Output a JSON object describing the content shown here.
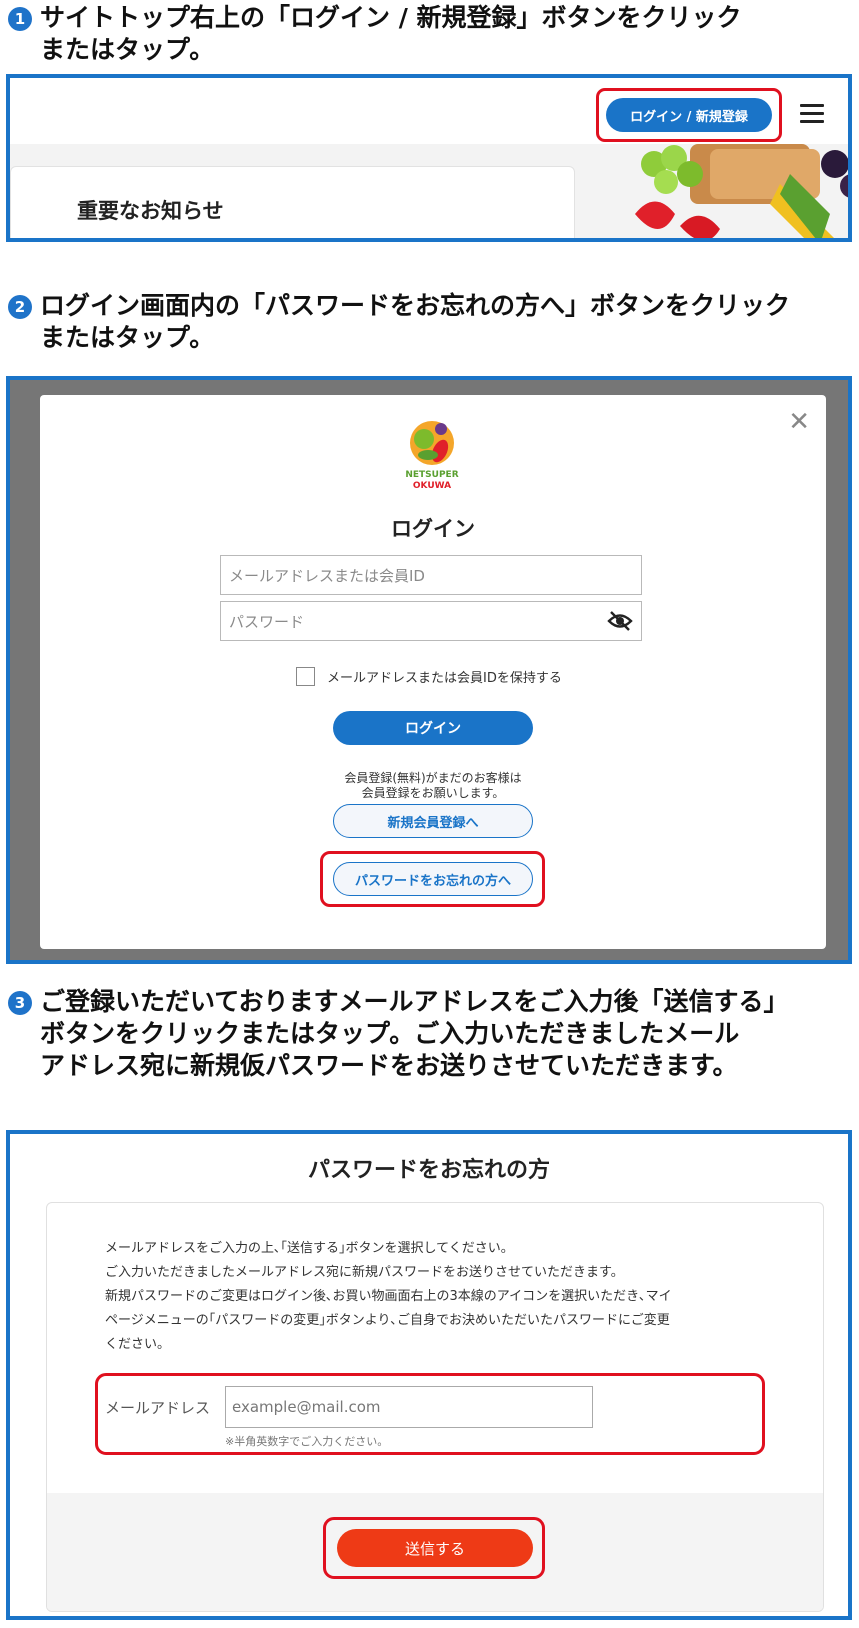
{
  "steps": [
    {
      "number": "1",
      "line1": "サイトトップ右上の「ログイン / 新規登録」ボタンをクリック",
      "line2": "またはタップ。"
    },
    {
      "number": "2",
      "line1": "ログイン画面内の「パスワードをお忘れの方へ」ボタンをクリック",
      "line2": "またはタップ。"
    },
    {
      "number": "3",
      "line1": "ご登録いただいておりますメールアドレスをご入力後「送信する」",
      "line2": "ボタンをクリックまたはタップ。ご入力いただきましたメール",
      "line3": "アドレス宛に新規仮パスワードをお送りさせていただきます。"
    }
  ],
  "site_header": {
    "login_register_button": "ログイン / 新規登録",
    "notice_title": "重要なお知らせ"
  },
  "login_modal": {
    "logo_line1": "NETSUPER",
    "logo_line2": "OKUWA",
    "title": "ログイン",
    "email_placeholder": "メールアドレスまたは会員ID",
    "password_placeholder": "パスワード",
    "remember_label": "メールアドレスまたは会員IDを保持する",
    "login_button": "ログイン",
    "register_note_line1": "会員登録(無料)がまだのお客様は",
    "register_note_line2": "会員登録をお願いします。",
    "register_button": "新規会員登録へ",
    "forgot_button": "パスワードをお忘れの方へ"
  },
  "forgot_page": {
    "title": "パスワードをお忘れの方",
    "instructions": [
      "メールアドレスをご入力の上､｢送信する｣ボタンを選択してください。",
      "ご入力いただきましたメールアドレス宛に新規パスワードをお送りさせていただきます。",
      "新規パスワードのご変更はログイン後､お買い物画面右上の3本線のアイコンを選択いただき､マイ",
      "ページメニューの｢パスワードの変更｣ボタンより､ご自身でお決めいただいたパスワードにご変更",
      "ください。"
    ],
    "email_label": "メールアドレス",
    "email_placeholder": "example@mail.com",
    "email_hint": "※半角英数字でご入力ください。",
    "send_button": "送信する"
  },
  "colors": {
    "primary_blue": "#1a74c8",
    "highlight_red": "#e0101f",
    "send_orange": "#ee3a16"
  }
}
